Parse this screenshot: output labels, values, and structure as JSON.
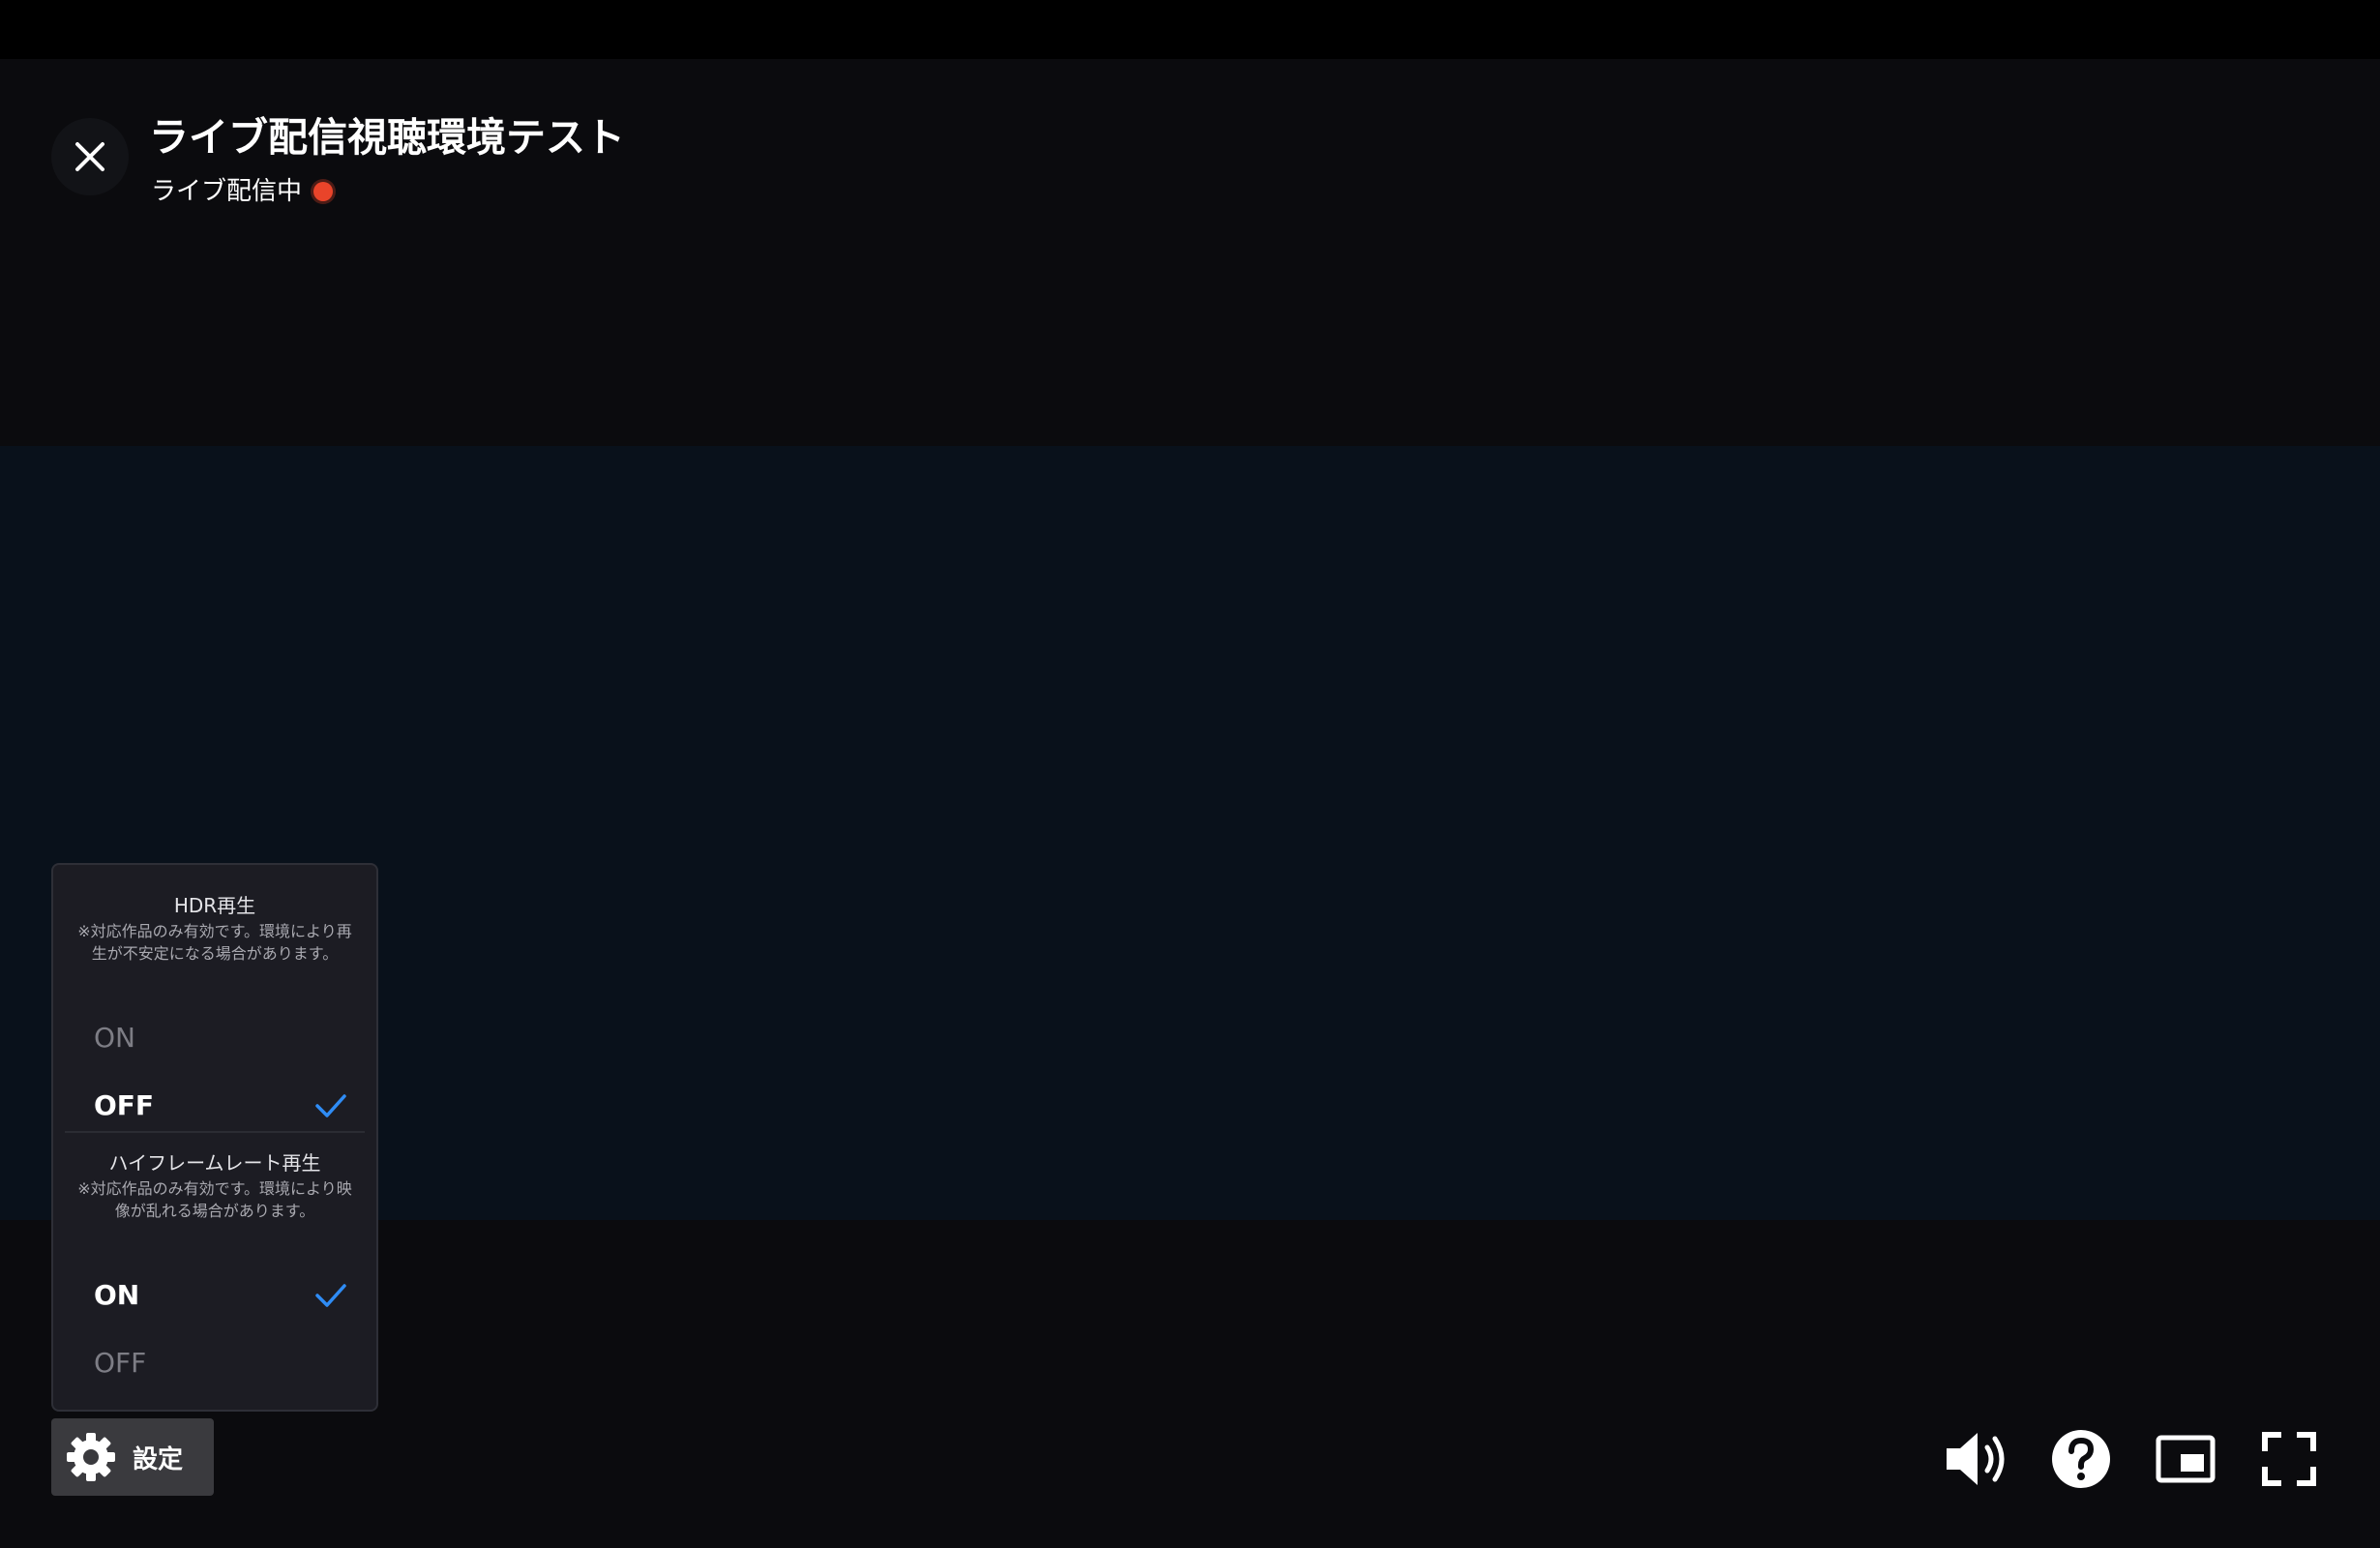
{
  "header": {
    "title": "ライブ配信視聴環境テスト",
    "live_status": "ライブ配信中"
  },
  "settings_panel": {
    "sections": [
      {
        "title": "HDR再生",
        "note": "※対応作品のみ有効です。環境により再生が不安定になる場合があります。",
        "options": [
          {
            "label": "ON",
            "selected": false
          },
          {
            "label": "OFF",
            "selected": true
          }
        ]
      },
      {
        "title": "ハイフレームレート再生",
        "note": "※対応作品のみ有効です。環境により映像が乱れる場合があります。",
        "options": [
          {
            "label": "ON",
            "selected": true
          },
          {
            "label": "OFF",
            "selected": false
          }
        ]
      }
    ]
  },
  "controls": {
    "settings_label": "設定",
    "icons": [
      "close-icon",
      "gear-icon",
      "volume-icon",
      "help-icon",
      "picture-in-picture-icon",
      "fullscreen-icon"
    ]
  },
  "colors": {
    "live_dot": "#e9442a",
    "checkmark": "#2f8cf5",
    "panel_bg": "#1c1c23",
    "video_band": "#09111b"
  }
}
